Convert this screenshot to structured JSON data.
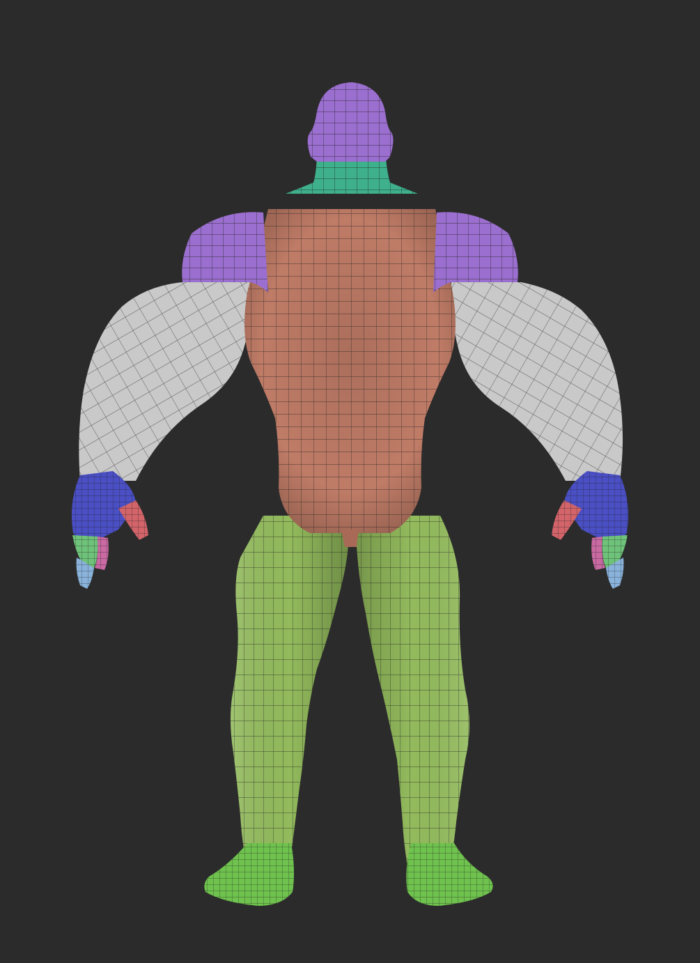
{
  "viewport": {
    "background": "#2b2b2b"
  },
  "polygroup_colors": {
    "head": "#9b6fcf",
    "neck": "#3fb08c",
    "torso": "#c9826c",
    "shoulders": "#9b6fcf",
    "upper_arms": "#c8c9c8",
    "hands": "#4a4fc4",
    "fingers_red": "#d2646a",
    "fingers_green": "#6fc27a",
    "fingers_pink": "#c96aa3",
    "fingers_lightblue": "#8ab3dc",
    "legs": "#93bb5d",
    "feet": "#6fc24e",
    "wire": "#1e1e1e"
  }
}
